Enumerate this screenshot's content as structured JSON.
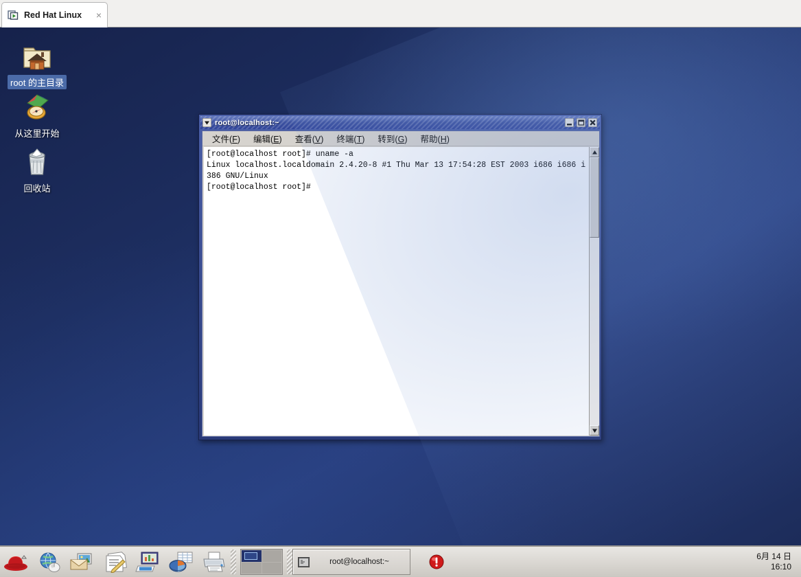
{
  "vm_tab": {
    "title": "Red Hat Linux",
    "close_label": "×",
    "icon": "vm-power-icon"
  },
  "desktop": {
    "icons": [
      {
        "label": "root 的主目录",
        "icon": "home-folder-icon",
        "selected": true
      },
      {
        "label": "从这里开始",
        "icon": "start-here-compass-icon",
        "selected": false
      },
      {
        "label": "回收站",
        "icon": "trash-can-icon",
        "selected": false
      }
    ]
  },
  "terminal": {
    "title": "root@localhost:~",
    "window_menu_icon": "chevron-down-icon",
    "buttons": {
      "minimize": "minimize-icon",
      "maximize": "maximize-icon",
      "close": "close-icon"
    },
    "menus": [
      {
        "label": "文件",
        "accel": "F"
      },
      {
        "label": "编辑",
        "accel": "E"
      },
      {
        "label": "查看",
        "accel": "V"
      },
      {
        "label": "终端",
        "accel": "T"
      },
      {
        "label": "转到",
        "accel": "G"
      },
      {
        "label": "帮助",
        "accel": "H"
      }
    ],
    "content": "[root@localhost root]# uname -a\nLinux localhost.localdomain 2.4.20-8 #1 Thu Mar 13 17:54:28 EST 2003 i686 i686 i\n386 GNU/Linux\n[root@localhost root]#",
    "scrollbar": {
      "up_arrow": "scroll-up-icon",
      "down_arrow": "scroll-down-icon",
      "thumb_position_pct": 0,
      "thumb_size_pct": 30
    }
  },
  "taskbar": {
    "launchers": [
      {
        "name": "red-hat-menu-icon",
        "title": "Red Hat"
      },
      {
        "name": "web-browser-icon",
        "title": "Mozilla"
      },
      {
        "name": "email-client-icon",
        "title": "Email"
      },
      {
        "name": "text-editor-icon",
        "title": "Writer"
      },
      {
        "name": "presentation-icon",
        "title": "Impress"
      },
      {
        "name": "spreadsheet-icon",
        "title": "Calc"
      },
      {
        "name": "printer-icon",
        "title": "Print Manager"
      }
    ],
    "workspaces": [
      {
        "active": true
      },
      {
        "active": false
      },
      {
        "active": false
      },
      {
        "active": false
      }
    ],
    "window_list": [
      {
        "label": "root@localhost:~",
        "icon": "terminal-window-icon",
        "active": false
      }
    ],
    "tray": [
      {
        "name": "alert-notifier-icon"
      }
    ],
    "clock": {
      "date": "6月 14 日",
      "time": "16:10"
    }
  },
  "colors": {
    "desktop_base": "#1d2e60",
    "titlebar": "#3d52a0",
    "panel": "#d9d6d1",
    "selection": "#4b6ba8",
    "redhat_red": "#c3191e"
  }
}
